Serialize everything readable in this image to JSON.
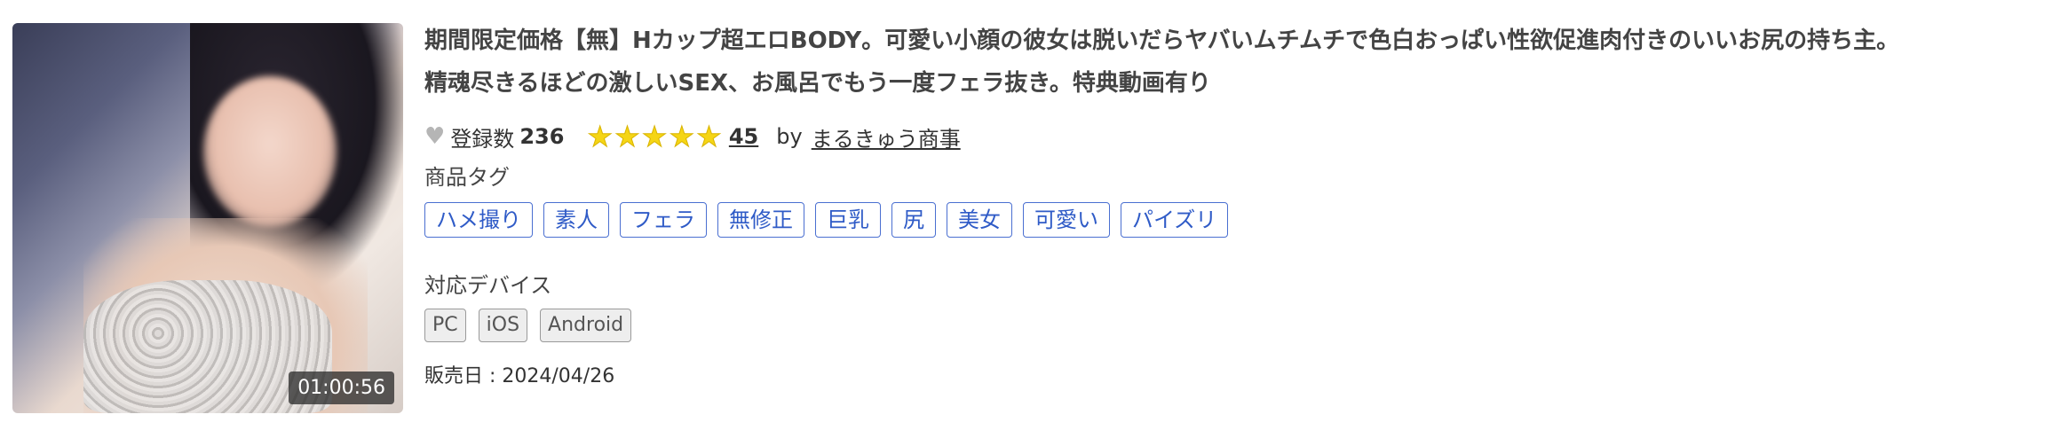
{
  "thumbnail": {
    "alt": "thumbnail",
    "duration": "01:00:56"
  },
  "title_line1": "期間限定価格【無】Hカップ超エロBODY。可愛い小顔の彼女は脱いだらヤバいムチムチで色白おっぱい性欲促進肉付きのいいお尻の持ち主。",
  "title_line2": "精魂尽きるほどの激しいSEX、お風呂でもう一度フェラ抜き。特典動画有り",
  "favorites": {
    "icon": "heart-icon",
    "label": "登録数",
    "count": "236"
  },
  "rating": {
    "stars": 5,
    "icon": "star-icon",
    "count": "45"
  },
  "seller": {
    "by": "by",
    "name": "まるきゅう商事"
  },
  "tags_label": "商品タグ",
  "tags": [
    "ハメ撮り",
    "素人",
    "フェラ",
    "無修正",
    "巨乳",
    "尻",
    "美女",
    "可愛い",
    "パイズリ"
  ],
  "devices_label": "対応デバイス",
  "devices": [
    "PC",
    "iOS",
    "Android"
  ],
  "release": "販売日 : 2024/04/26",
  "colors": {
    "tag_border": "#4a6fd1",
    "star": "#f5d515",
    "heart": "#b5b5b5"
  }
}
